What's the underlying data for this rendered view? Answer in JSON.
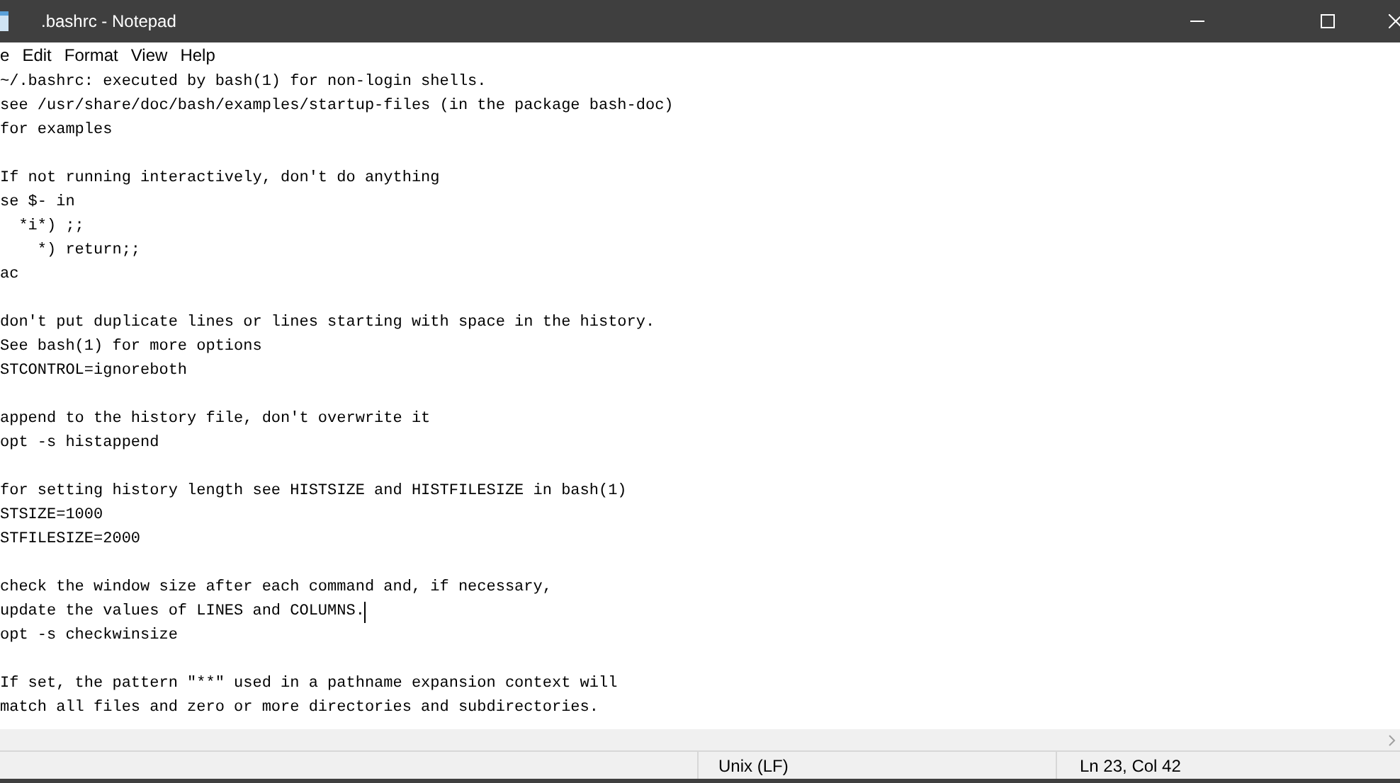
{
  "window": {
    "title": ".bashrc - Notepad"
  },
  "menu": [
    "e",
    "Edit",
    "Format",
    "View",
    "Help"
  ],
  "editor": {
    "blocks": [
      {
        "lines": [
          {
            "text": "~/.bashrc: executed by bash(1) for non-login shells.",
            "caret": false
          },
          {
            "text": "see /usr/share/doc/bash/examples/startup-files (in the package bash-doc)",
            "caret": false
          },
          {
            "text": "for examples",
            "caret": false
          }
        ]
      },
      {
        "lines": [
          {
            "text": "If not running interactively, don't do anything",
            "caret": false
          },
          {
            "text": "se $- in",
            "caret": false
          },
          {
            "text": "  *i*) ;;",
            "caret": false
          },
          {
            "text": "    *) return;;",
            "caret": false
          },
          {
            "text": "ac",
            "caret": false
          }
        ]
      },
      {
        "lines": [
          {
            "text": "don't put duplicate lines or lines starting with space in the history.",
            "caret": false
          },
          {
            "text": "See bash(1) for more options",
            "caret": false
          },
          {
            "text": "STCONTROL=ignoreboth",
            "caret": false
          }
        ]
      },
      {
        "lines": [
          {
            "text": "append to the history file, don't overwrite it",
            "caret": false
          },
          {
            "text": "opt -s histappend",
            "caret": false
          }
        ]
      },
      {
        "lines": [
          {
            "text": "for setting history length see HISTSIZE and HISTFILESIZE in bash(1)",
            "caret": false
          },
          {
            "text": "STSIZE=1000",
            "caret": false
          },
          {
            "text": "STFILESIZE=2000",
            "caret": false
          }
        ]
      },
      {
        "lines": [
          {
            "text": "check the window size after each command and, if necessary,",
            "caret": false
          },
          {
            "text": "update the values of LINES and COLUMNS.",
            "caret": true
          },
          {
            "text": "opt -s checkwinsize",
            "caret": false
          }
        ]
      },
      {
        "lines": [
          {
            "text": "If set, the pattern \"**\" used in a pathname expansion context will",
            "caret": false
          },
          {
            "text": "match all files and zero or more directories and subdirectories.",
            "caret": false
          }
        ]
      }
    ]
  },
  "status_bar": {
    "line_ending": "Unix (LF)",
    "position": "Ln 23, Col 42"
  }
}
